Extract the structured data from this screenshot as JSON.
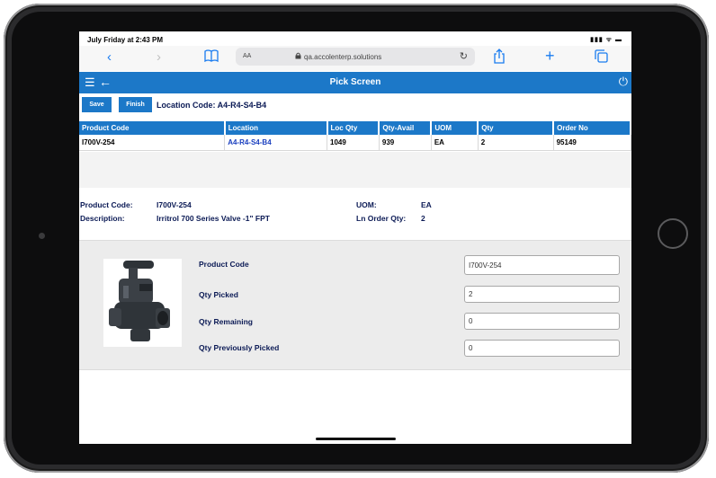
{
  "status_bar": {
    "time": "July Friday at 2:43 PM",
    "indicators": "▮▮▮ ᯤ ▬"
  },
  "browser": {
    "back_icon": "‹",
    "forward_icon": "›",
    "bookmarks_icon": "📖",
    "text_size": "AA",
    "lock_icon": "🔒",
    "url": "qa.accolenterp.solutions",
    "reload_icon": "↻",
    "share_icon": "⇪",
    "new_tab_icon": "+",
    "tabs_icon": "⧉"
  },
  "appbar": {
    "menu_icon": "☰",
    "back_icon": "←",
    "title": "Pick Screen",
    "power_icon": "⏻"
  },
  "toolbar": {
    "save_label": "Save",
    "finish_label": "Finish",
    "location_code_text": "Location Code: A4-R4-S4-B4"
  },
  "grid": {
    "headers": [
      "Product Code",
      "Location",
      "Loc Qty",
      "Qty-Avail",
      "UOM",
      "Qty",
      "Order No"
    ],
    "rows": [
      [
        "I700V-254",
        "A4-R4-S4-B4",
        "1049",
        "939",
        "EA",
        "2",
        "95149"
      ]
    ]
  },
  "details": {
    "product_code_label": "Product Code:",
    "product_code_value": "I700V-254",
    "description_label": "Description:",
    "description_value": "Irritrol 700 Series Valve -1\" FPT",
    "uom_label": "UOM:",
    "uom_value": "EA",
    "ln_order_qty_label": "Ln Order Qty:",
    "ln_order_qty_value": "2"
  },
  "form": {
    "product_code_label": "Product Code",
    "product_code_value": "I700V-254",
    "qty_picked_label": "Qty Picked",
    "qty_picked_value": "2",
    "qty_remaining_label": "Qty Remaining",
    "qty_remaining_value": "0",
    "qty_prev_picked_label": "Qty Previously Picked",
    "qty_prev_picked_value": "0"
  },
  "colors": {
    "accent": "#1c78c8",
    "label_text": "#0b1a55",
    "link": "#1a3fbf"
  }
}
